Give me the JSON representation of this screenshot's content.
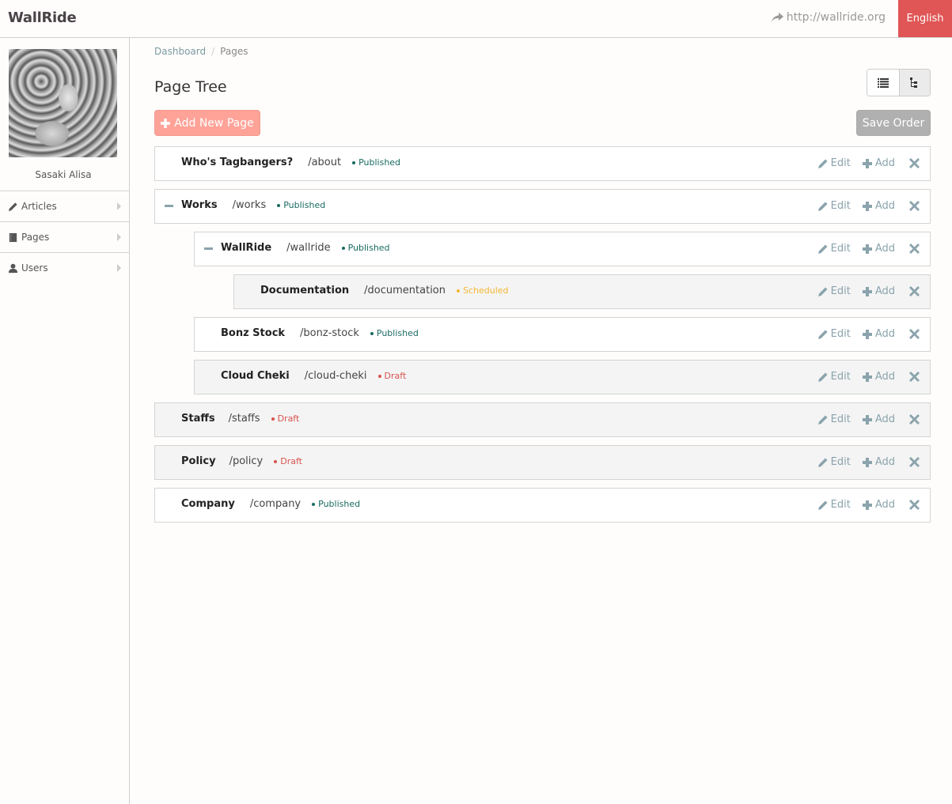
{
  "navbar": {
    "brand": "WallRide",
    "site_link": "http://wallride.org",
    "language": "English"
  },
  "sidebar": {
    "user_name": "Sasaki Alisa",
    "items": [
      {
        "label": "Articles",
        "icon": "pencil-icon"
      },
      {
        "label": "Pages",
        "icon": "book-icon"
      },
      {
        "label": "Users",
        "icon": "user-icon"
      }
    ]
  },
  "breadcrumb": {
    "items": [
      "Dashboard",
      "Pages"
    ],
    "separator": "/"
  },
  "main": {
    "title": "Page Tree",
    "add_new_page_label": "Add New Page",
    "save_order_label": "Save Order",
    "view_modes": [
      "list-view",
      "tree-view"
    ],
    "active_view": "tree-view",
    "edit_label": "Edit",
    "add_label": "Add"
  },
  "status_colors": {
    "Published": "#1a6b63",
    "Scheduled": "#f5b731",
    "Draft": "#d9534f"
  },
  "pages": [
    {
      "title": "Who's Tagbangers?",
      "slug": "/about",
      "status": "Published",
      "depth": 0,
      "collapsible": false
    },
    {
      "title": "Works",
      "slug": "/works",
      "status": "Published",
      "depth": 0,
      "collapsible": true
    },
    {
      "title": "WallRide",
      "slug": "/wallride",
      "status": "Published",
      "depth": 1,
      "collapsible": true
    },
    {
      "title": "Documentation",
      "slug": "/documentation",
      "status": "Scheduled",
      "depth": 2,
      "collapsible": false
    },
    {
      "title": "Bonz Stock",
      "slug": "/bonz-stock",
      "status": "Published",
      "depth": 1,
      "collapsible": false
    },
    {
      "title": "Cloud Cheki",
      "slug": "/cloud-cheki",
      "status": "Draft",
      "depth": 1,
      "collapsible": false
    },
    {
      "title": "Staffs",
      "slug": "/staffs",
      "status": "Draft",
      "depth": 0,
      "collapsible": false
    },
    {
      "title": "Policy",
      "slug": "/policy",
      "status": "Draft",
      "depth": 0,
      "collapsible": false
    },
    {
      "title": "Company",
      "slug": "/company",
      "status": "Published",
      "depth": 0,
      "collapsible": false
    }
  ]
}
